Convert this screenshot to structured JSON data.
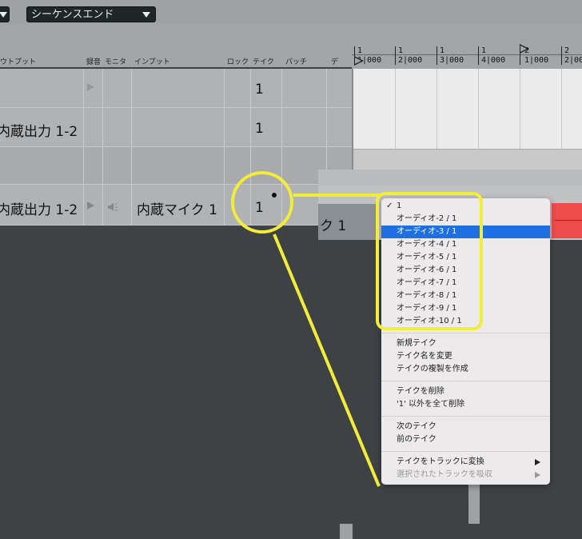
{
  "toolbar": {
    "left_dropdown_label": "",
    "sequence_end_label": "シーケンスエンド"
  },
  "columns": {
    "output": "ウトプット",
    "record": "録音",
    "monitor": "モニタ",
    "input": "インプット",
    "lock": "ロック",
    "take": "テイク",
    "patch": "パッチ",
    "extra": "デ"
  },
  "ruler": {
    "bars": [
      {
        "top": "1",
        "bottom": "1|000"
      },
      {
        "top": "1",
        "bottom": "2|000"
      },
      {
        "top": "1",
        "bottom": "3|000"
      },
      {
        "top": "1",
        "bottom": "4|000"
      },
      {
        "top": "2",
        "bottom": "1|000"
      },
      {
        "top": "2",
        "bottom": "2|00"
      }
    ]
  },
  "tracks": [
    {
      "output": "",
      "take": "1"
    },
    {
      "output": "内蔵出力 1-2",
      "take": "1"
    },
    {
      "output": "",
      "take": ""
    },
    {
      "output": "内蔵出力 1-2",
      "take": "1",
      "input": "内蔵マイク 1"
    }
  ],
  "region_label": "ク 1",
  "take_menu": {
    "takes": [
      {
        "label": "1",
        "checked": true
      },
      {
        "label": "オーディオ-2 / 1"
      },
      {
        "label": "オーディオ-3 / 1",
        "selected": true
      },
      {
        "label": "オーディオ-4 / 1"
      },
      {
        "label": "オーディオ-5 / 1"
      },
      {
        "label": "オーディオ-6 / 1"
      },
      {
        "label": "オーディオ-7 / 1"
      },
      {
        "label": "オーディオ-8 / 1"
      },
      {
        "label": "オーディオ-9 / 1"
      },
      {
        "label": "オーディオ-10 / 1"
      }
    ],
    "check_mark": "✓",
    "new_take": "新規テイク",
    "rename_take": "テイク名を変更",
    "duplicate_take": "テイクの複製を作成",
    "delete_take": "テイクを削除",
    "delete_all_except": "'1' 以外を全て削除",
    "next_take": "次のテイク",
    "prev_take": "前のテイク",
    "convert_to_tracks": "テイクをトラックに変換",
    "absorb_selected": "選択されたトラックを吸収"
  },
  "colors": {
    "highlight": "#f2ec3a",
    "selection": "#1f6fe0",
    "clip_red": "#ee4b4b"
  }
}
